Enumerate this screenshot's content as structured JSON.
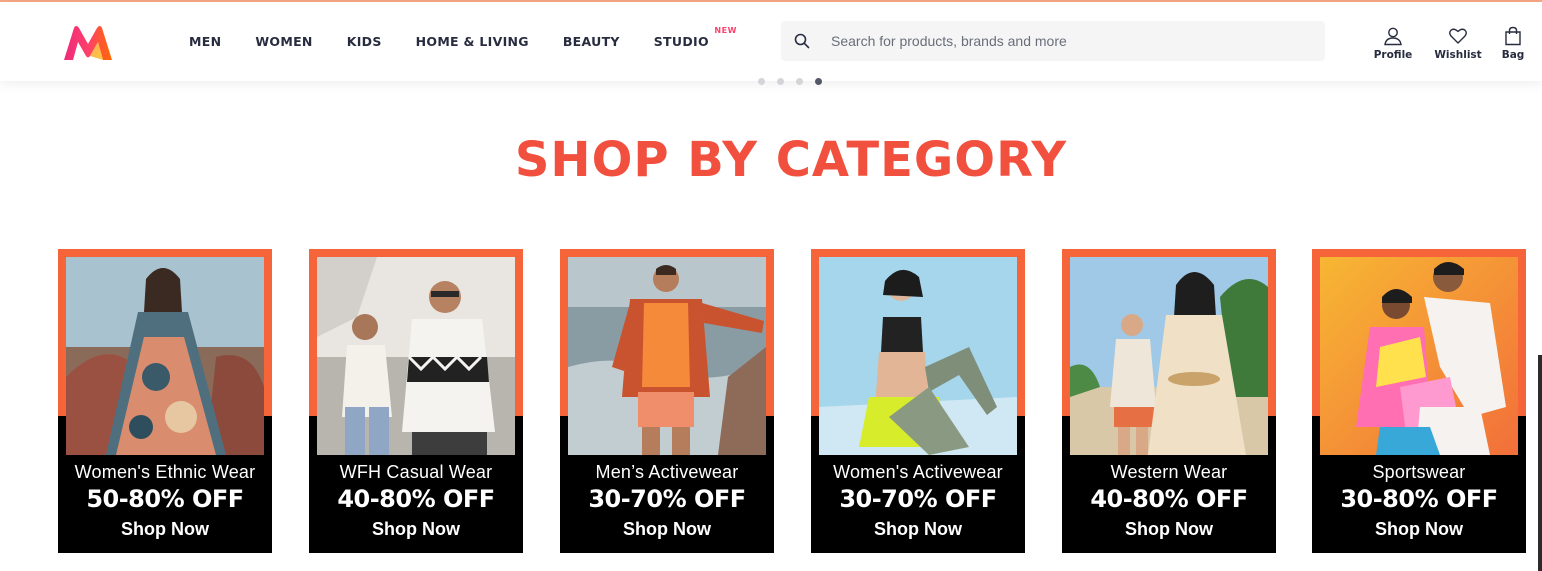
{
  "nav": {
    "items": [
      "MEN",
      "WOMEN",
      "KIDS",
      "HOME & LIVING",
      "BEAUTY",
      "STUDIO"
    ],
    "new_badge": "NEW"
  },
  "search": {
    "placeholder": "Search for products, brands and more",
    "icon": "search-icon"
  },
  "actions": [
    {
      "label": "Profile",
      "icon": "profile-icon"
    },
    {
      "label": "Wishlist",
      "icon": "heart-icon"
    },
    {
      "label": "Bag",
      "icon": "bag-icon"
    }
  ],
  "carousel": {
    "dot_count": 4,
    "active_index": 3
  },
  "section": {
    "title": "SHOP BY CATEGORY"
  },
  "cards": [
    {
      "category": "Women's Ethnic Wear",
      "offer": "50-80% OFF",
      "cta": "Shop Now"
    },
    {
      "category": "WFH Casual Wear",
      "offer": "40-80% OFF",
      "cta": "Shop Now"
    },
    {
      "category": "Men’s Activewear",
      "offer": "30-70% OFF",
      "cta": "Shop Now"
    },
    {
      "category": "Women's Activewear",
      "offer": "30-70% OFF",
      "cta": "Shop Now"
    },
    {
      "category": "Western Wear",
      "offer": "40-80% OFF",
      "cta": "Shop Now"
    },
    {
      "category": "Sportswear",
      "offer": "30-80% OFF",
      "cta": "Shop Now"
    }
  ],
  "colors": {
    "brand_pink": "#ff3f6c",
    "title_red": "#f2503e",
    "card_orange": "#f6653a",
    "card_black": "#000000"
  }
}
